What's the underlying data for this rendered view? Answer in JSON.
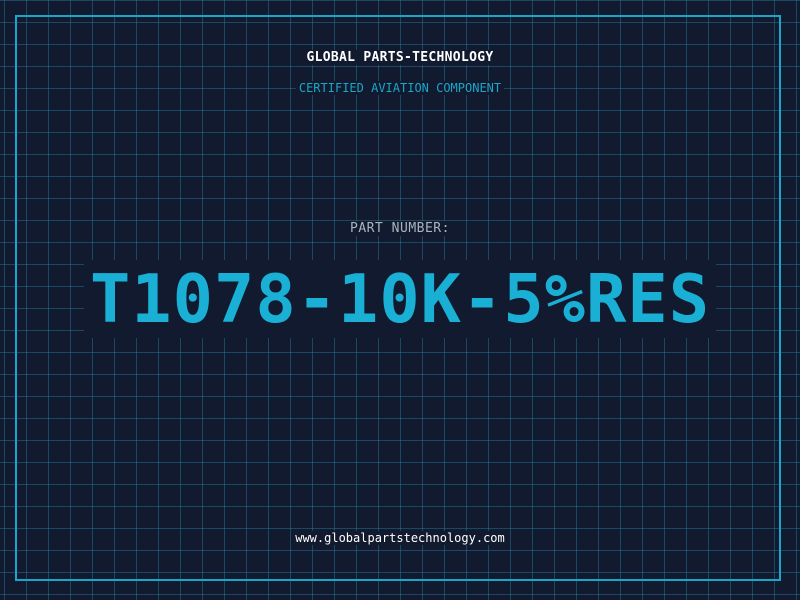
{
  "header": {
    "company": "GLOBAL PARTS-TECHNOLOGY",
    "tagline": "CERTIFIED AVIATION COMPONENT"
  },
  "main": {
    "label": "PART NUMBER:",
    "part_number": "T1078-10K-5%RES"
  },
  "footer": {
    "url": "www.globalpartstechnology.com"
  },
  "colors": {
    "background": "#111a2e",
    "grid": "#1f6f86",
    "accent": "#1ab0d6",
    "text": "#ffffff",
    "label": "#aab4bf"
  }
}
